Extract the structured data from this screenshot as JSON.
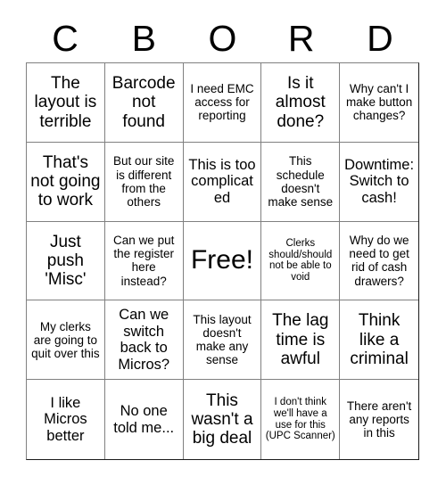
{
  "card": {
    "title_letters": [
      "C",
      "B",
      "O",
      "R",
      "D"
    ],
    "rows": [
      [
        {
          "text": "The layout is terrible",
          "size": "lg"
        },
        {
          "text": "Barcode not found",
          "size": "lg"
        },
        {
          "text": "I need EMC access for reporting",
          "size": "sm"
        },
        {
          "text": "Is it almost done?",
          "size": "lg"
        },
        {
          "text": "Why can't I make button changes?",
          "size": "sm"
        }
      ],
      [
        {
          "text": "That's not going to work",
          "size": "lg"
        },
        {
          "text": "But our site is different from the others",
          "size": "sm"
        },
        {
          "text": "This is too complicated",
          "size": "md"
        },
        {
          "text": "This schedule doesn't make sense",
          "size": "sm"
        },
        {
          "text": "Downtime: Switch to cash!",
          "size": "md"
        }
      ],
      [
        {
          "text": "Just push 'Misc'",
          "size": "lg"
        },
        {
          "text": "Can we put the register here instead?",
          "size": "sm"
        },
        {
          "text": "Free!",
          "size": "xl"
        },
        {
          "text": "Clerks should/should not be able to void",
          "size": "xs"
        },
        {
          "text": "Why do we need to get rid of cash drawers?",
          "size": "sm"
        }
      ],
      [
        {
          "text": "My clerks are going to quit over this",
          "size": "sm"
        },
        {
          "text": "Can we switch back to Micros?",
          "size": "md"
        },
        {
          "text": "This layout doesn't make any sense",
          "size": "sm"
        },
        {
          "text": "The lag time is awful",
          "size": "lg"
        },
        {
          "text": "Think like a criminal",
          "size": "lg"
        }
      ],
      [
        {
          "text": "I like Micros better",
          "size": "md"
        },
        {
          "text": "No one told me...",
          "size": "md"
        },
        {
          "text": "This wasn't a big deal",
          "size": "lg"
        },
        {
          "text": "I don't think we'll have a use for this (UPC Scanner)",
          "size": "xs"
        },
        {
          "text": "There aren't any reports in this",
          "size": "sm"
        }
      ]
    ]
  },
  "colors": {
    "background": "#ffffff",
    "text": "#000000",
    "inner_border": "#808080",
    "outer_border": "#1a1a1a"
  }
}
